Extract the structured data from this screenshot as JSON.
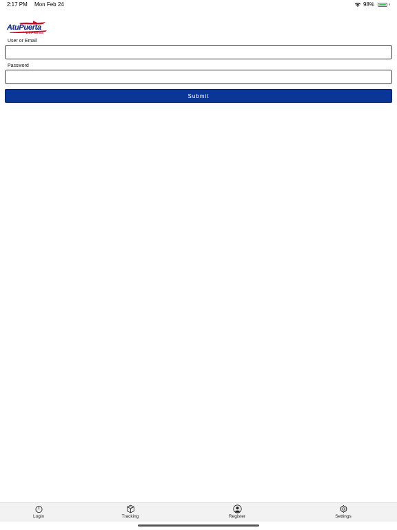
{
  "status_bar": {
    "time": "2:17 PM",
    "date": "Mon Feb 24",
    "battery_percent": "98%",
    "battery_level": 0.98,
    "icons": [
      "wifi-icon",
      "battery-icon"
    ]
  },
  "logo": {
    "text": "AtuPuerta",
    "subtext": "EXPRESS",
    "colors": {
      "primary": "#1a2e8a",
      "accent": "#c8102e"
    }
  },
  "form": {
    "user_label": "User or Email",
    "user_value": "",
    "password_label": "Password",
    "password_value": "",
    "submit_label": "Submit",
    "submit_color": "#0a3599"
  },
  "tab_bar": {
    "tabs": [
      {
        "label": "Login",
        "icon": "power-icon"
      },
      {
        "label": "Tracking",
        "icon": "box-icon"
      },
      {
        "label": "Register",
        "icon": "person-circle-icon"
      },
      {
        "label": "Settings",
        "icon": "gear-icon"
      }
    ]
  }
}
